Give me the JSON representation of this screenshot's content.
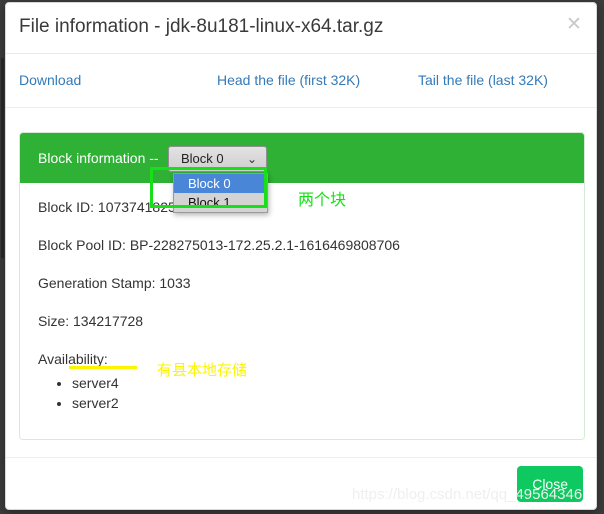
{
  "dialog": {
    "title": "File information - jdk-8u181-linux-x64.tar.gz",
    "close_icon": "close-x-icon",
    "close_icon_glyph": "✕"
  },
  "links": [
    {
      "label": "Download"
    },
    {
      "label": "Head the file (first 32K)"
    },
    {
      "label": "Tail the file (last 32K)"
    }
  ],
  "panel": {
    "heading_label": "Block information --",
    "accent_color": "#2eb135",
    "select": {
      "value": "Block 0",
      "chevron_icon": "chevron-down-icon",
      "chevron_glyph": "⌄",
      "options": [
        {
          "label": "Block 0",
          "selected": true
        },
        {
          "label": "Block 1",
          "selected": false
        }
      ]
    },
    "info": [
      {
        "text": "Block ID: 1073741825"
      },
      {
        "text": "Block Pool ID: BP-228275013-172.25.2.1-1616469808706"
      },
      {
        "text": "Generation Stamp: 1033"
      },
      {
        "text": "Size: 134217728"
      }
    ],
    "availability_label": "Availability:",
    "availability": [
      {
        "name": "server4"
      },
      {
        "name": "server2"
      }
    ]
  },
  "footer": {
    "close_label": "Close",
    "close_color": "#0ec95f"
  },
  "annotations": {
    "green_text": "两个块",
    "green_color": "#17e017",
    "yellow_text": "有县本地存储",
    "yellow_color": "#fdf500"
  },
  "watermark": {
    "text": "https://blog.csdn.net/qq_49564346"
  }
}
